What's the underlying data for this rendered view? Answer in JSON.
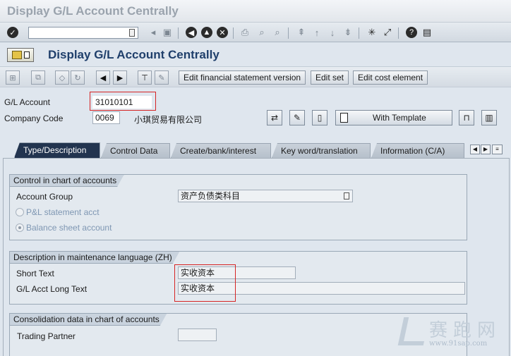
{
  "window": {
    "title": "Display G/L Account Centrally"
  },
  "screen": {
    "title": "Display G/L Account Centrally"
  },
  "systoolbar": {
    "command_value": ""
  },
  "apptoolbar": {
    "buttons": [
      "Edit financial statement version",
      "Edit set",
      "Edit cost element"
    ]
  },
  "header": {
    "gl_account_label": "G/L Account",
    "gl_account_value": "31010101",
    "company_code_label": "Company Code",
    "company_code_value": "0069",
    "company_name": "小琪贸易有限公司",
    "with_template_label": "With Template"
  },
  "tabs": [
    {
      "label": "Type/Description",
      "active": true
    },
    {
      "label": "Control Data",
      "active": false
    },
    {
      "label": "Create/bank/interest",
      "active": false
    },
    {
      "label": "Key word/translation",
      "active": false
    },
    {
      "label": "Information (C/A)",
      "active": false
    }
  ],
  "control_group": {
    "title": "Control in chart of accounts",
    "account_group_label": "Account Group",
    "account_group_value": "资产负债类科目",
    "pl_label": "P&L statement acct",
    "bs_label": "Balance sheet account",
    "selected": "Balance sheet account"
  },
  "description_group": {
    "title": "Description in maintenance language (ZH)",
    "short_text_label": "Short Text",
    "short_text_value": "实收资本",
    "long_text_label": "G/L Acct Long Text",
    "long_text_value": "实收资本"
  },
  "consolidation_group": {
    "title": "Consolidation data in chart of accounts",
    "trading_partner_label": "Trading Partner",
    "trading_partner_value": ""
  },
  "watermark": {
    "text": "赛跑网",
    "url": "www.91sap.com"
  },
  "colors": {
    "active_tab": "#22344f",
    "title": "#1f3f6b",
    "highlight": "#d62424"
  }
}
